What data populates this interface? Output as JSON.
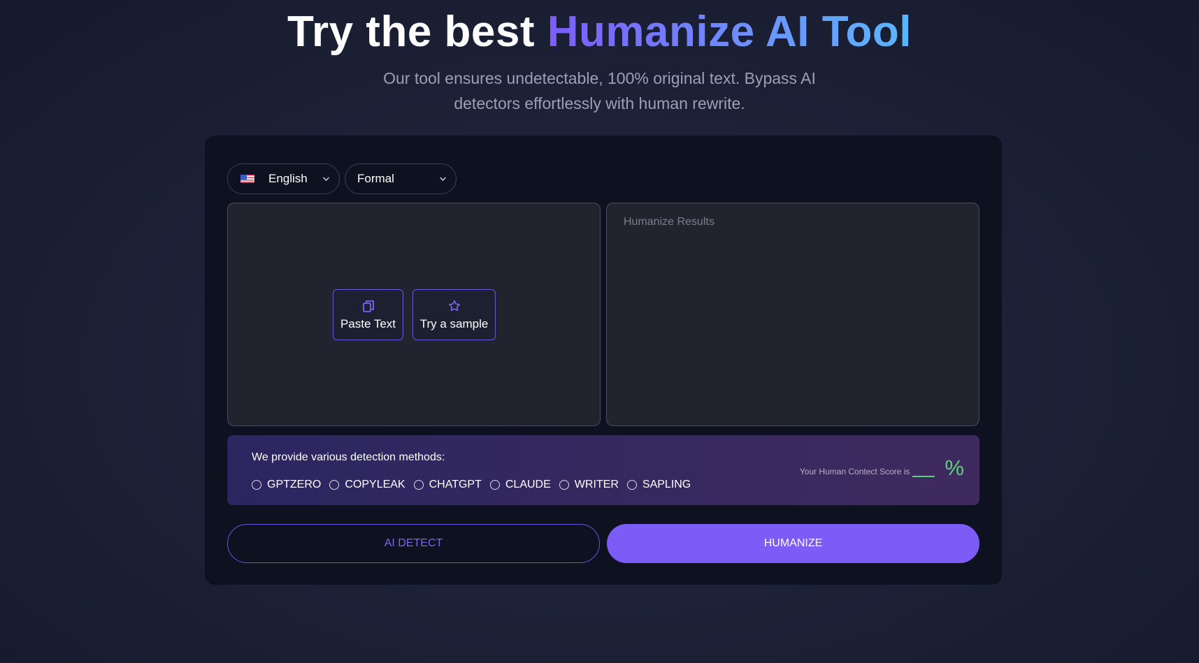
{
  "hero": {
    "title_prefix": "Try the best ",
    "title_accent": "Humanize AI Tool",
    "subtitle_line1": "Our tool ensures undetectable, 100% original text. Bypass AI",
    "subtitle_line2": "detectors effortlessly with human rewrite."
  },
  "controls": {
    "language": "English",
    "language_flag_icon": "us-flag-icon",
    "tone": "Formal"
  },
  "input_panel": {
    "paste_label": "Paste Text",
    "sample_label": "Try a sample"
  },
  "output_panel": {
    "placeholder": "Humanize Results"
  },
  "detection": {
    "title": "We provide various detection methods:",
    "methods": [
      "GPTZERO",
      "COPYLEAK",
      "CHATGPT",
      "CLAUDE",
      "WRITER",
      "SAPLING"
    ],
    "score_label": "Your Human Contect Score is",
    "score_unit": "%"
  },
  "actions": {
    "detect_label": "AI DETECT",
    "humanize_label": "HUMANIZE"
  },
  "colors": {
    "accent": "#7b5cf6",
    "score_green": "#5fd07a"
  }
}
